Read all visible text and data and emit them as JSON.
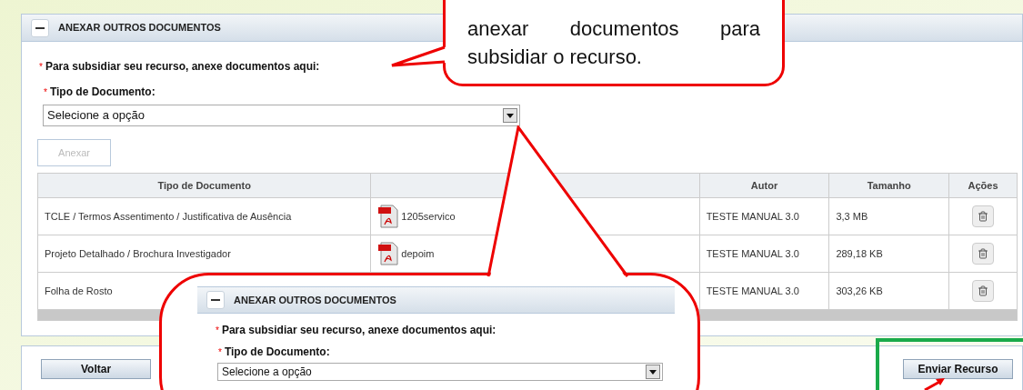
{
  "panel": {
    "title": "ANEXAR OUTROS DOCUMENTOS",
    "expanded": true
  },
  "intro": {
    "required_mark": "*",
    "text": "Para subsidiar seu recurso, anexe documentos aqui:"
  },
  "field": {
    "required_mark": "*",
    "label": "Tipo de Documento:",
    "value": "Selecione a opção"
  },
  "attach_button": {
    "label": "Anexar",
    "disabled": true
  },
  "table": {
    "columns": [
      {
        "label": "Tipo de Documento"
      },
      {},
      {
        "label": "Autor"
      },
      {
        "label": "Tamanho"
      },
      {
        "label": "Ações"
      }
    ],
    "rows": [
      {
        "type": "TCLE / Termos Assentimento / Justificativa de Ausência",
        "file": "1205servico",
        "author": "TESTE MANUAL 3.0",
        "size": "3,3 MB"
      },
      {
        "type": "Projeto Detalhado / Brochura Investigador",
        "file": "depoim",
        "author": "TESTE MANUAL 3.0",
        "size": "289,18 KB"
      },
      {
        "type": "Folha de Rosto",
        "author": "TESTE MANUAL 3.0",
        "size": "303,26 KB"
      }
    ]
  },
  "footer": {
    "back": "Voltar",
    "submit": "Enviar Recurso"
  },
  "callout_top": {
    "text": "anexar documentos para subsidiar o recurso."
  },
  "callout_bottom": {
    "panel_title": "ANEXAR OUTROS DOCUMENTOS",
    "intro_mark": "*",
    "intro": "Para subsidiar seu recurso, anexe documentos aqui:",
    "field_mark": "*",
    "field_label": "Tipo de Documento:",
    "field_value": "Selecione a opção"
  }
}
